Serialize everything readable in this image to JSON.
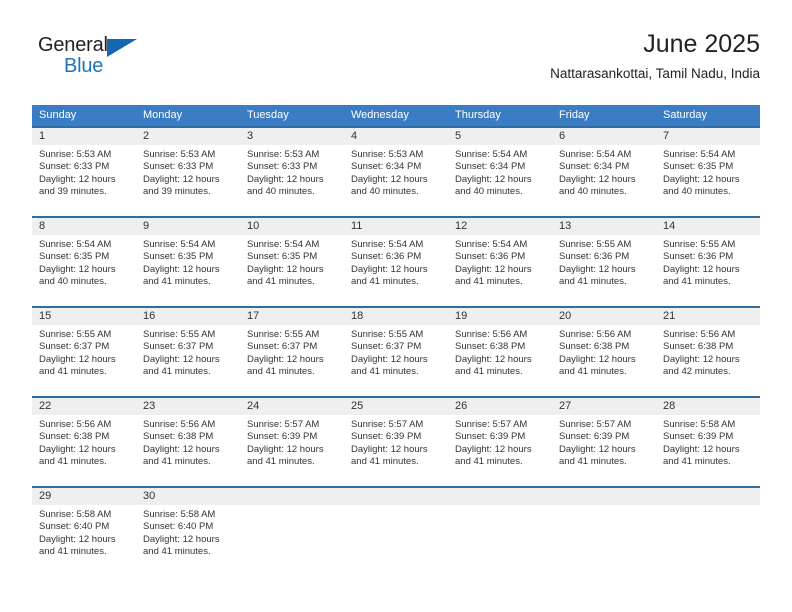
{
  "brand": {
    "name_part1": "General",
    "name_part2": "Blue",
    "triangle_color": "#1667b1",
    "part1_color": "#231f20",
    "part2_color": "#1b75bb"
  },
  "header": {
    "title": "June 2025",
    "subtitle": "Nattarasankottai, Tamil Nadu, India"
  },
  "theme": {
    "header_bg": "#3b7dc4",
    "row_border": "#2e6da4",
    "daynum_bg": "#efefef",
    "text": "#333333"
  },
  "weekday_headers": [
    "Sunday",
    "Monday",
    "Tuesday",
    "Wednesday",
    "Thursday",
    "Friday",
    "Saturday"
  ],
  "weeks": [
    [
      {
        "day": "1",
        "sunrise": "Sunrise: 5:53 AM",
        "sunset": "Sunset: 6:33 PM",
        "daylight_line1": "Daylight: 12 hours",
        "daylight_line2": "and 39 minutes."
      },
      {
        "day": "2",
        "sunrise": "Sunrise: 5:53 AM",
        "sunset": "Sunset: 6:33 PM",
        "daylight_line1": "Daylight: 12 hours",
        "daylight_line2": "and 39 minutes."
      },
      {
        "day": "3",
        "sunrise": "Sunrise: 5:53 AM",
        "sunset": "Sunset: 6:33 PM",
        "daylight_line1": "Daylight: 12 hours",
        "daylight_line2": "and 40 minutes."
      },
      {
        "day": "4",
        "sunrise": "Sunrise: 5:53 AM",
        "sunset": "Sunset: 6:34 PM",
        "daylight_line1": "Daylight: 12 hours",
        "daylight_line2": "and 40 minutes."
      },
      {
        "day": "5",
        "sunrise": "Sunrise: 5:54 AM",
        "sunset": "Sunset: 6:34 PM",
        "daylight_line1": "Daylight: 12 hours",
        "daylight_line2": "and 40 minutes."
      },
      {
        "day": "6",
        "sunrise": "Sunrise: 5:54 AM",
        "sunset": "Sunset: 6:34 PM",
        "daylight_line1": "Daylight: 12 hours",
        "daylight_line2": "and 40 minutes."
      },
      {
        "day": "7",
        "sunrise": "Sunrise: 5:54 AM",
        "sunset": "Sunset: 6:35 PM",
        "daylight_line1": "Daylight: 12 hours",
        "daylight_line2": "and 40 minutes."
      }
    ],
    [
      {
        "day": "8",
        "sunrise": "Sunrise: 5:54 AM",
        "sunset": "Sunset: 6:35 PM",
        "daylight_line1": "Daylight: 12 hours",
        "daylight_line2": "and 40 minutes."
      },
      {
        "day": "9",
        "sunrise": "Sunrise: 5:54 AM",
        "sunset": "Sunset: 6:35 PM",
        "daylight_line1": "Daylight: 12 hours",
        "daylight_line2": "and 41 minutes."
      },
      {
        "day": "10",
        "sunrise": "Sunrise: 5:54 AM",
        "sunset": "Sunset: 6:35 PM",
        "daylight_line1": "Daylight: 12 hours",
        "daylight_line2": "and 41 minutes."
      },
      {
        "day": "11",
        "sunrise": "Sunrise: 5:54 AM",
        "sunset": "Sunset: 6:36 PM",
        "daylight_line1": "Daylight: 12 hours",
        "daylight_line2": "and 41 minutes."
      },
      {
        "day": "12",
        "sunrise": "Sunrise: 5:54 AM",
        "sunset": "Sunset: 6:36 PM",
        "daylight_line1": "Daylight: 12 hours",
        "daylight_line2": "and 41 minutes."
      },
      {
        "day": "13",
        "sunrise": "Sunrise: 5:55 AM",
        "sunset": "Sunset: 6:36 PM",
        "daylight_line1": "Daylight: 12 hours",
        "daylight_line2": "and 41 minutes."
      },
      {
        "day": "14",
        "sunrise": "Sunrise: 5:55 AM",
        "sunset": "Sunset: 6:36 PM",
        "daylight_line1": "Daylight: 12 hours",
        "daylight_line2": "and 41 minutes."
      }
    ],
    [
      {
        "day": "15",
        "sunrise": "Sunrise: 5:55 AM",
        "sunset": "Sunset: 6:37 PM",
        "daylight_line1": "Daylight: 12 hours",
        "daylight_line2": "and 41 minutes."
      },
      {
        "day": "16",
        "sunrise": "Sunrise: 5:55 AM",
        "sunset": "Sunset: 6:37 PM",
        "daylight_line1": "Daylight: 12 hours",
        "daylight_line2": "and 41 minutes."
      },
      {
        "day": "17",
        "sunrise": "Sunrise: 5:55 AM",
        "sunset": "Sunset: 6:37 PM",
        "daylight_line1": "Daylight: 12 hours",
        "daylight_line2": "and 41 minutes."
      },
      {
        "day": "18",
        "sunrise": "Sunrise: 5:55 AM",
        "sunset": "Sunset: 6:37 PM",
        "daylight_line1": "Daylight: 12 hours",
        "daylight_line2": "and 41 minutes."
      },
      {
        "day": "19",
        "sunrise": "Sunrise: 5:56 AM",
        "sunset": "Sunset: 6:38 PM",
        "daylight_line1": "Daylight: 12 hours",
        "daylight_line2": "and 41 minutes."
      },
      {
        "day": "20",
        "sunrise": "Sunrise: 5:56 AM",
        "sunset": "Sunset: 6:38 PM",
        "daylight_line1": "Daylight: 12 hours",
        "daylight_line2": "and 41 minutes."
      },
      {
        "day": "21",
        "sunrise": "Sunrise: 5:56 AM",
        "sunset": "Sunset: 6:38 PM",
        "daylight_line1": "Daylight: 12 hours",
        "daylight_line2": "and 42 minutes."
      }
    ],
    [
      {
        "day": "22",
        "sunrise": "Sunrise: 5:56 AM",
        "sunset": "Sunset: 6:38 PM",
        "daylight_line1": "Daylight: 12 hours",
        "daylight_line2": "and 41 minutes."
      },
      {
        "day": "23",
        "sunrise": "Sunrise: 5:56 AM",
        "sunset": "Sunset: 6:38 PM",
        "daylight_line1": "Daylight: 12 hours",
        "daylight_line2": "and 41 minutes."
      },
      {
        "day": "24",
        "sunrise": "Sunrise: 5:57 AM",
        "sunset": "Sunset: 6:39 PM",
        "daylight_line1": "Daylight: 12 hours",
        "daylight_line2": "and 41 minutes."
      },
      {
        "day": "25",
        "sunrise": "Sunrise: 5:57 AM",
        "sunset": "Sunset: 6:39 PM",
        "daylight_line1": "Daylight: 12 hours",
        "daylight_line2": "and 41 minutes."
      },
      {
        "day": "26",
        "sunrise": "Sunrise: 5:57 AM",
        "sunset": "Sunset: 6:39 PM",
        "daylight_line1": "Daylight: 12 hours",
        "daylight_line2": "and 41 minutes."
      },
      {
        "day": "27",
        "sunrise": "Sunrise: 5:57 AM",
        "sunset": "Sunset: 6:39 PM",
        "daylight_line1": "Daylight: 12 hours",
        "daylight_line2": "and 41 minutes."
      },
      {
        "day": "28",
        "sunrise": "Sunrise: 5:58 AM",
        "sunset": "Sunset: 6:39 PM",
        "daylight_line1": "Daylight: 12 hours",
        "daylight_line2": "and 41 minutes."
      }
    ],
    [
      {
        "day": "29",
        "sunrise": "Sunrise: 5:58 AM",
        "sunset": "Sunset: 6:40 PM",
        "daylight_line1": "Daylight: 12 hours",
        "daylight_line2": "and 41 minutes."
      },
      {
        "day": "30",
        "sunrise": "Sunrise: 5:58 AM",
        "sunset": "Sunset: 6:40 PM",
        "daylight_line1": "Daylight: 12 hours",
        "daylight_line2": "and 41 minutes."
      },
      {
        "day": "",
        "sunrise": "",
        "sunset": "",
        "daylight_line1": "",
        "daylight_line2": ""
      },
      {
        "day": "",
        "sunrise": "",
        "sunset": "",
        "daylight_line1": "",
        "daylight_line2": ""
      },
      {
        "day": "",
        "sunrise": "",
        "sunset": "",
        "daylight_line1": "",
        "daylight_line2": ""
      },
      {
        "day": "",
        "sunrise": "",
        "sunset": "",
        "daylight_line1": "",
        "daylight_line2": ""
      },
      {
        "day": "",
        "sunrise": "",
        "sunset": "",
        "daylight_line1": "",
        "daylight_line2": ""
      }
    ]
  ]
}
